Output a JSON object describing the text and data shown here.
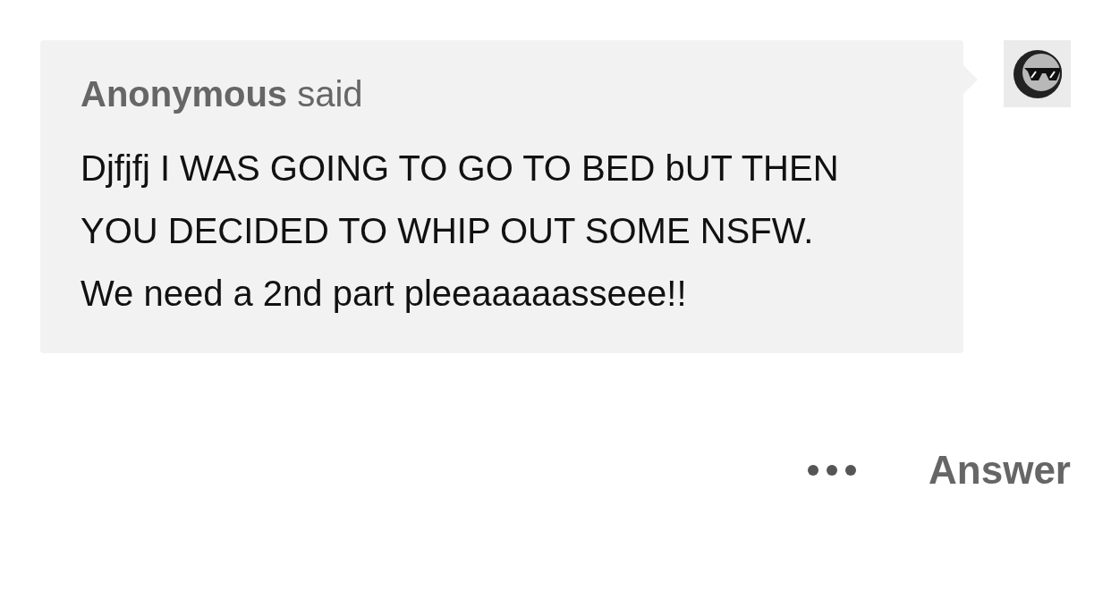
{
  "ask": {
    "header": "**Anonymous** said",
    "message": "Djfjfj I WAS GOING TO GO TO BED bUT THEN YOU DECIDED TO WHIP OUT SOME NSFW. We need a 2nd part pleeaaaaasseee!!"
  },
  "actions": {
    "answer": "Answer"
  }
}
